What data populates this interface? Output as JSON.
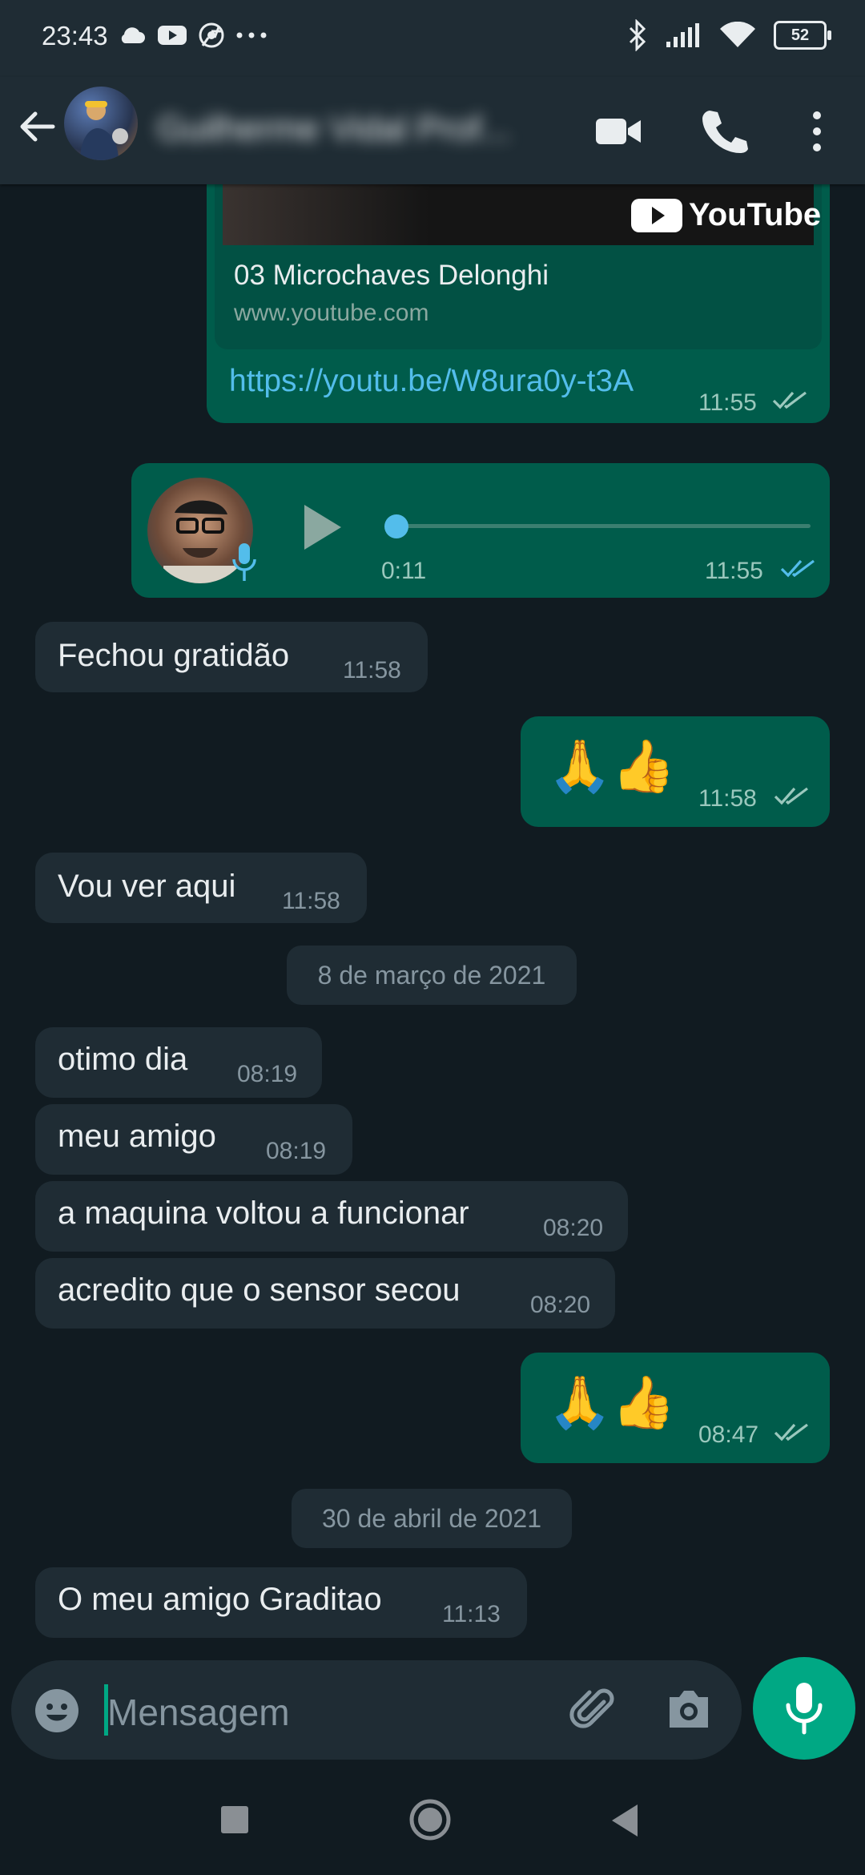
{
  "status_bar": {
    "time": "23:43",
    "icons_left": [
      "cloud-icon",
      "youtube-icon",
      "chrome-icon",
      "more-dots-icon"
    ],
    "icons_right": [
      "bluetooth-icon",
      "signal-icon",
      "wifi-icon",
      "battery-icon"
    ],
    "battery": "52"
  },
  "header": {
    "contact_name": "Guilherme Vidal Prof...",
    "icons": [
      "back-arrow-icon",
      "video-call-icon",
      "phone-icon",
      "more-vert-icon"
    ]
  },
  "chat": {
    "link_preview": {
      "title": "03 Microchaves Delonghi",
      "domain": "www.youtube.com",
      "url": "https://youtu.be/W8ura0y-t3A",
      "time": "11:55",
      "thumb_logo": "YouTube"
    },
    "voice_note": {
      "duration": "0:11",
      "time": "11:55",
      "progress": 0
    },
    "messages": [
      {
        "dir": "in",
        "text": "Fechou gratidão",
        "time": "11:58"
      },
      {
        "dir": "out",
        "text": "🙏👍",
        "time": "11:58"
      },
      {
        "dir": "in",
        "text": "Vou ver aqui",
        "time": "11:58"
      },
      {
        "dir": "in",
        "text": "otimo dia",
        "time": "08:19"
      },
      {
        "dir": "in",
        "text": "meu amigo",
        "time": "08:19"
      },
      {
        "dir": "in",
        "text": "a maquina voltou a funcionar",
        "time": "08:20"
      },
      {
        "dir": "in",
        "text": "acredito que o sensor secou",
        "time": "08:20"
      },
      {
        "dir": "out",
        "text": "🙏👍",
        "time": "08:47"
      },
      {
        "dir": "in",
        "text": "O meu amigo Graditao",
        "time": "11:13"
      }
    ],
    "dates": [
      "8 de março de 2021",
      "30 de abril de 2021"
    ]
  },
  "input": {
    "placeholder": "Mensagem",
    "icons": [
      "emoji-icon",
      "attach-icon",
      "camera-icon",
      "mic-icon"
    ]
  },
  "nav": {
    "icons": [
      "recents-icon",
      "home-icon",
      "back-icon"
    ]
  },
  "colors": {
    "background": "#111b21",
    "bar": "#1f2c34",
    "incoming": "#1f2c34",
    "outgoing": "#005c4b",
    "accent": "#00a884",
    "link": "#53bdeb",
    "read_ticks": "#53bdeb"
  }
}
